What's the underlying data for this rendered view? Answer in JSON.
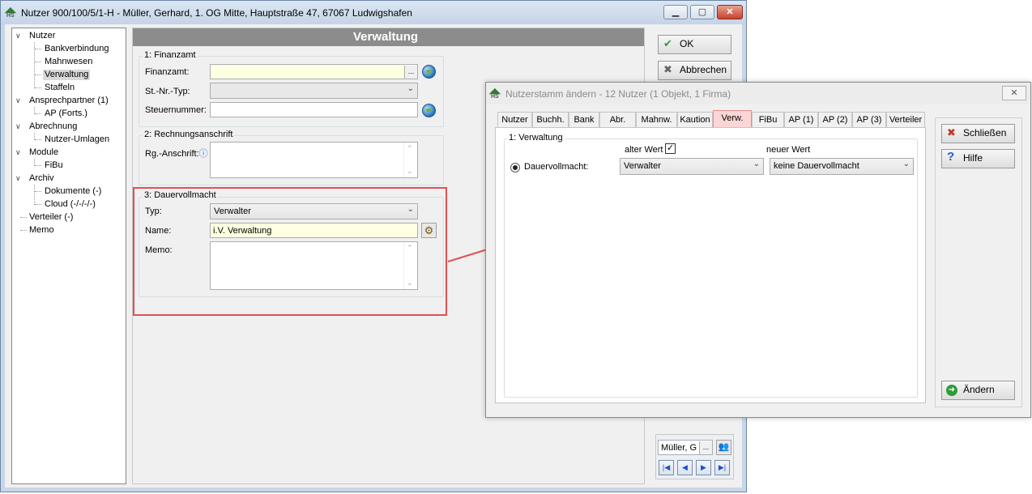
{
  "main_window": {
    "title": "Nutzer 900/100/5/1-H - Müller, Gerhard, 1. OG Mitte, Hauptstraße 47, 67067 Ludwigshafen",
    "icon_text": "HS",
    "tree": [
      {
        "label": "Nutzer"
      },
      {
        "label": "Bankverbindung"
      },
      {
        "label": "Mahnwesen"
      },
      {
        "label": "Verwaltung"
      },
      {
        "label": "Staffeln"
      },
      {
        "label": "Ansprechpartner (1)"
      },
      {
        "label": "AP (Forts.)"
      },
      {
        "label": "Abrechnung"
      },
      {
        "label": "Nutzer-Umlagen"
      },
      {
        "label": "Module"
      },
      {
        "label": "FiBu"
      },
      {
        "label": "Archiv"
      },
      {
        "label": "Dokumente (-)"
      },
      {
        "label": "Cloud (-/-/-/-)"
      },
      {
        "label": "Verteiler (-)"
      },
      {
        "label": "Memo"
      }
    ],
    "section_title": "Verwaltung",
    "finanzamt_group": {
      "title": "1: Finanzamt",
      "finanzamt_label": "Finanzamt:",
      "finanzamt_value": "",
      "ellipsis": "...",
      "stnr_typ_label": "St.-Nr.-Typ:",
      "stnr_typ_value": "",
      "steuernummer_label": "Steuernummer:",
      "steuernummer_value": ""
    },
    "rechnung_group": {
      "title": "2: Rechnungsanschrift",
      "anschrift_label": "Rg.-Anschrift:",
      "info_glyph": "ⓘ"
    },
    "dauervollmacht_group": {
      "title": "3: Dauervollmacht",
      "typ_label": "Typ:",
      "typ_value": "Verwalter",
      "name_label": "Name:",
      "name_value": "i.V. Verwaltung",
      "memo_label": "Memo:"
    },
    "buttons": {
      "ok": "OK",
      "cancel": "Abbrechen"
    },
    "nav": {
      "record_value": "Müller, G",
      "ellipsis": "..."
    }
  },
  "dialog": {
    "title": "Nutzerstamm ändern - 12 Nutzer (1 Objekt, 1 Firma)",
    "icon_text": "HS",
    "close_glyph": "✕",
    "tabs": [
      {
        "label": "Nutzer"
      },
      {
        "label": "Buchh."
      },
      {
        "label": "Bank"
      },
      {
        "label": "Abr."
      },
      {
        "label": "Mahnw."
      },
      {
        "label": "Kaution"
      },
      {
        "label": "Verw."
      },
      {
        "label": "FiBu"
      },
      {
        "label": "AP (1)"
      },
      {
        "label": "AP (2)"
      },
      {
        "label": "AP (3)"
      },
      {
        "label": "Verteiler"
      }
    ],
    "active_tab": "Verw.",
    "group_title": "1: Verwaltung",
    "alter_wert_label": "alter Wert",
    "alter_wert_checked": true,
    "neuer_wert_label": "neuer Wert",
    "row_label": "Dauervollmacht:",
    "old_value": "Verwalter",
    "new_value": "keine Dauervollmacht",
    "buttons": {
      "close": "Schließen",
      "help": "Hilfe",
      "change": "Ändern"
    }
  },
  "colors": {
    "highlight_border": "#e05050",
    "yellow_field": "#ffffe1",
    "header_gray": "#8c8c8c",
    "active_tab": "#fbd6d6"
  }
}
